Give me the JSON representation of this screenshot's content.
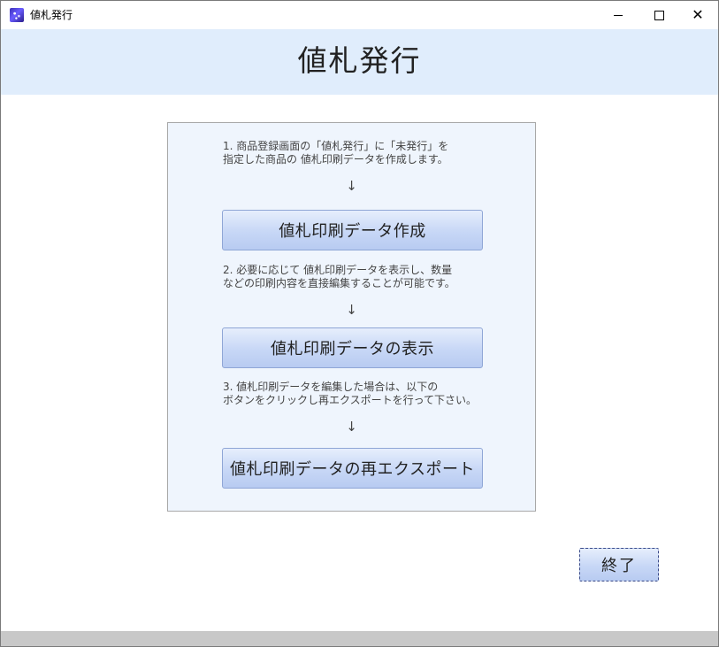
{
  "window": {
    "title": "値札発行",
    "minimize_icon": "minimize-icon",
    "maximize_icon": "maximize-icon",
    "close_icon": "close-icon",
    "close_glyph": "✕"
  },
  "header": {
    "title": "値札発行"
  },
  "steps": [
    {
      "text": "1. 商品登録画面の「値札発行」に「未発行」を\n指定した商品の 値札印刷データを作成します。",
      "arrow": "↓",
      "button_label": "値札印刷データ作成"
    },
    {
      "text": "2. 必要に応じて 値札印刷データを表示し、数量\nなどの印刷内容を直接編集することが可能です。",
      "arrow": "↓",
      "button_label": "値札印刷データの表示"
    },
    {
      "text": "3. 値札印刷データを編集した場合は、以下の\nボタンをクリックし再エクスポートを行って下さい。",
      "arrow": "↓",
      "button_label": "値札印刷データの再エクスポート"
    }
  ],
  "footer": {
    "exit_label": "終了"
  },
  "colors": {
    "header_band": "#e0edfc",
    "panel_bg": "#eff5fd",
    "button_top": "#e6eefc",
    "button_bottom": "#b8cbf1"
  }
}
